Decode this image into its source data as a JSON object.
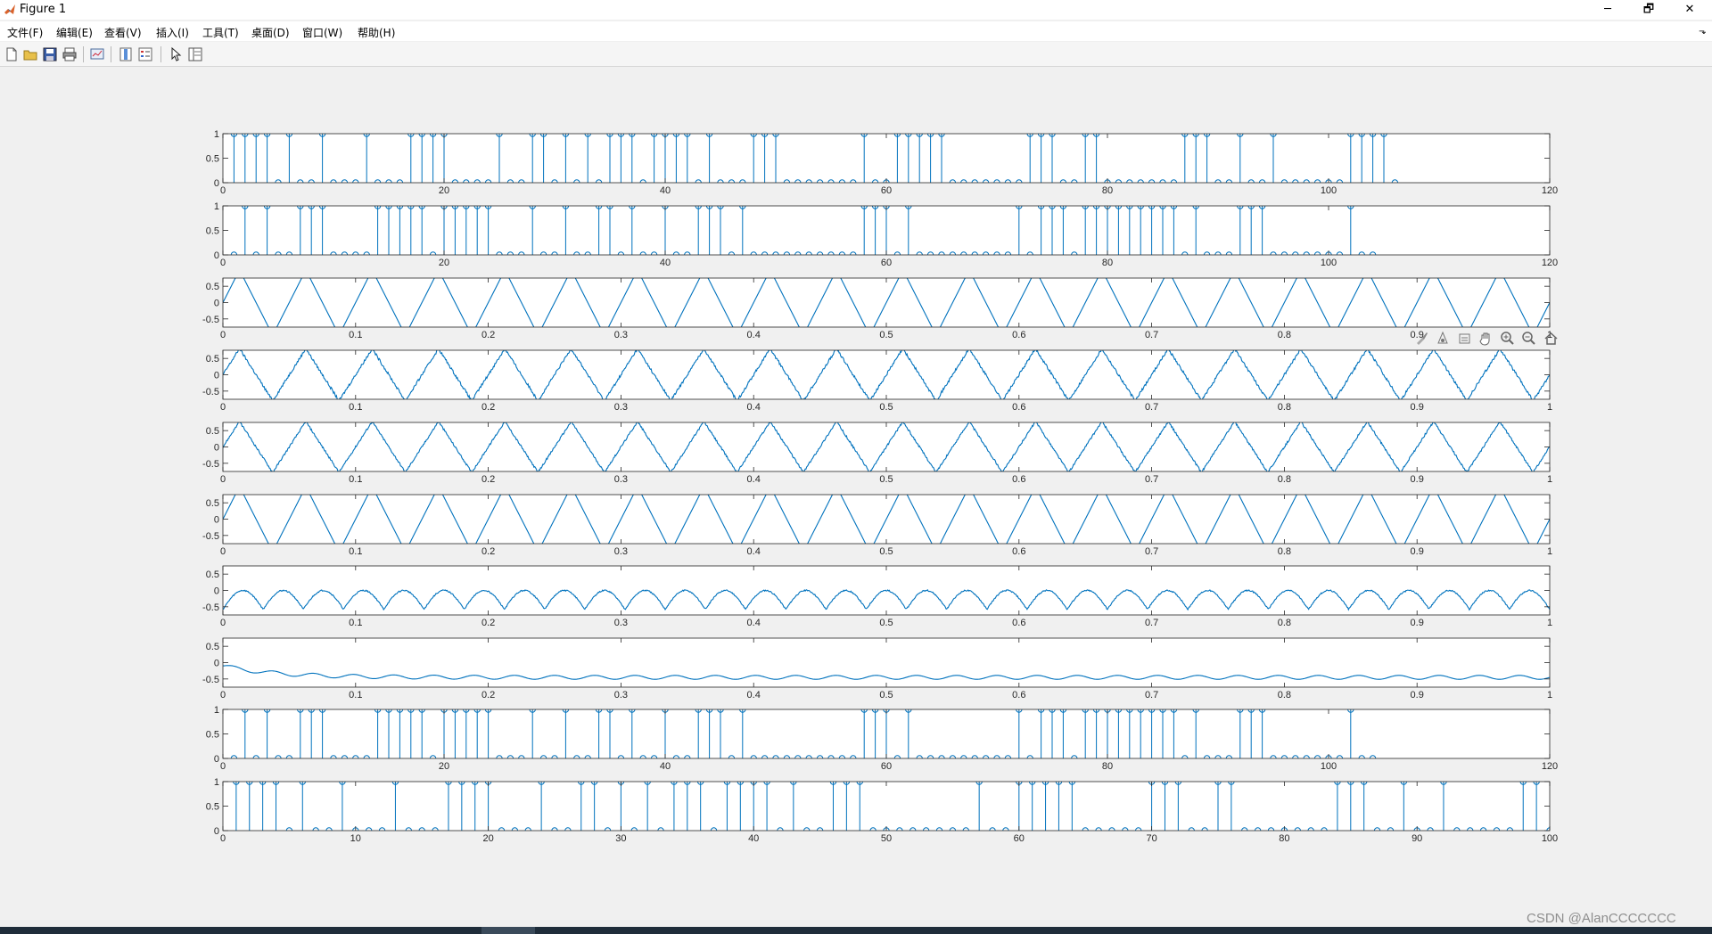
{
  "window": {
    "title": "Figure 1",
    "controls": {
      "minimize": "─",
      "maximize": "🗗",
      "close": "✕"
    }
  },
  "menu": {
    "items": [
      "文件(F)",
      "编辑(E)",
      "查看(V)",
      "插入(I)",
      "工具(T)",
      "桌面(D)",
      "窗口(W)",
      "帮助(H)"
    ],
    "overflow_arrow": "⬎"
  },
  "toolbar": {
    "icons": [
      "new-figure-icon",
      "open-file-icon",
      "save-icon",
      "print-icon",
      "link-plot-icon",
      "insert-colorbar-icon",
      "insert-legend-icon",
      "edit-plot-arrow-icon",
      "property-inspector-icon"
    ]
  },
  "axes_toolbar": {
    "icons": [
      "brush-icon",
      "data-tip-icon",
      "export-icon",
      "pan-hand-icon",
      "zoom-in-icon",
      "zoom-out-icon",
      "home-icon"
    ]
  },
  "colors": {
    "line": "#0072bd",
    "axes_bg": "#ffffff",
    "figure_bg": "#f0f0f0"
  },
  "watermark": "CSDN @AlanCCCCCCC",
  "chart_data": [
    {
      "type": "stem",
      "xlim": [
        0,
        120
      ],
      "ylim": [
        0,
        1
      ],
      "xticks": [
        "0",
        "20",
        "40",
        "60",
        "80",
        "100",
        "120"
      ],
      "yticks": [
        "0",
        "0.5",
        "1"
      ],
      "x_start": 1,
      "values": [
        1,
        1,
        1,
        1,
        0,
        1,
        0,
        0,
        1,
        0,
        0,
        0,
        1,
        0,
        0,
        0,
        1,
        1,
        1,
        1,
        0,
        0,
        0,
        0,
        1,
        0,
        0,
        1,
        1,
        0,
        1,
        0,
        1,
        0,
        1,
        1,
        1,
        0,
        1,
        1,
        1,
        1,
        0,
        1,
        0,
        0,
        0,
        1,
        1,
        1,
        0,
        0,
        0,
        0,
        0,
        0,
        0,
        1,
        0,
        0,
        1,
        1,
        1,
        1,
        1,
        0,
        0,
        0,
        0,
        0,
        0,
        0,
        1,
        1,
        1,
        0,
        0,
        1,
        1,
        0,
        0,
        0,
        0,
        0,
        0,
        0,
        1,
        1,
        1,
        0,
        0,
        1,
        0,
        0,
        1,
        0,
        0,
        0,
        0,
        0,
        0,
        1,
        1,
        1,
        1,
        0
      ]
    },
    {
      "type": "stem",
      "xlim": [
        0,
        120
      ],
      "ylim": [
        0,
        1
      ],
      "xticks": [
        "0",
        "20",
        "40",
        "60",
        "80",
        "100",
        "120"
      ],
      "yticks": [
        "0",
        "0.5",
        "1"
      ],
      "x_start": 1,
      "values": [
        0,
        1,
        0,
        1,
        0,
        0,
        1,
        1,
        1,
        0,
        0,
        0,
        0,
        1,
        1,
        1,
        1,
        1,
        0,
        1,
        1,
        1,
        1,
        1,
        0,
        0,
        0,
        1,
        0,
        0,
        1,
        0,
        0,
        1,
        1,
        0,
        1,
        0,
        0,
        1,
        0,
        0,
        1,
        1,
        1,
        0,
        1,
        0,
        0,
        0,
        0,
        0,
        0,
        0,
        0,
        0,
        0,
        1,
        1,
        1,
        0,
        1,
        0,
        0,
        0,
        0,
        0,
        0,
        0,
        0,
        0,
        1,
        0,
        1,
        1,
        1,
        0,
        1,
        1,
        1,
        1,
        1,
        1,
        1,
        1,
        1,
        0,
        1,
        0,
        0,
        0,
        1,
        1,
        1,
        0,
        0,
        0,
        0,
        0,
        0,
        0,
        1,
        0,
        0
      ]
    },
    {
      "type": "line",
      "shape": "triangle",
      "xlim": [
        0,
        1
      ],
      "ylim": [
        -0.75,
        0.75
      ],
      "xticks": [
        "0",
        "0.1",
        "0.2",
        "0.3",
        "0.4",
        "0.5",
        "0.6",
        "0.7",
        "0.8",
        "0.9",
        "1"
      ],
      "yticks": [
        "0.5",
        "0",
        "-0.5"
      ],
      "frequency": 20,
      "amplitude": 1,
      "noise": 0,
      "offset": 0
    },
    {
      "type": "line",
      "shape": "triangle",
      "xlim": [
        0,
        1
      ],
      "ylim": [
        -0.75,
        0.75
      ],
      "xticks": [
        "0",
        "0.1",
        "0.2",
        "0.3",
        "0.4",
        "0.5",
        "0.6",
        "0.7",
        "0.8",
        "0.9",
        "1"
      ],
      "yticks": [
        "0.5",
        "0",
        "-0.5"
      ],
      "frequency": 20,
      "amplitude": 0.8,
      "noise": 0.04,
      "offset": 0
    },
    {
      "type": "line",
      "shape": "triangle",
      "xlim": [
        0,
        1
      ],
      "ylim": [
        -0.75,
        0.75
      ],
      "xticks": [
        "0",
        "0.1",
        "0.2",
        "0.3",
        "0.4",
        "0.5",
        "0.6",
        "0.7",
        "0.8",
        "0.9",
        "1"
      ],
      "yticks": [
        "0.5",
        "0",
        "-0.5"
      ],
      "frequency": 20,
      "amplitude": 0.78,
      "noise": 0.03,
      "offset": 0
    },
    {
      "type": "line",
      "shape": "triangle",
      "xlim": [
        0,
        1
      ],
      "ylim": [
        -0.75,
        0.75
      ],
      "xticks": [
        "0",
        "0.1",
        "0.2",
        "0.3",
        "0.4",
        "0.5",
        "0.6",
        "0.7",
        "0.8",
        "0.9",
        "1"
      ],
      "yticks": [
        "0.5",
        "0",
        "-0.5"
      ],
      "frequency": 20,
      "amplitude": 1,
      "noise": 0,
      "offset": 0
    },
    {
      "type": "line",
      "shape": "bump",
      "xlim": [
        0,
        1
      ],
      "ylim": [
        -0.75,
        0.75
      ],
      "xticks": [
        "0",
        "0.1",
        "0.2",
        "0.3",
        "0.4",
        "0.5",
        "0.6",
        "0.7",
        "0.8",
        "0.9",
        "1"
      ],
      "yticks": [
        "0.5",
        "0",
        "-0.5"
      ],
      "frequency": 33,
      "amplitude": 0.58,
      "noise": 0.02,
      "offset": -0.58
    },
    {
      "type": "line",
      "shape": "ripple",
      "xlim": [
        0,
        1
      ],
      "ylim": [
        -0.75,
        0.75
      ],
      "xticks": [
        "0",
        "0.1",
        "0.2",
        "0.3",
        "0.4",
        "0.5",
        "0.6",
        "0.7",
        "0.8",
        "0.9",
        "1"
      ],
      "yticks": [
        "0.5",
        "0",
        "-0.5"
      ],
      "frequency": 33,
      "amplitude": 0.06,
      "noise": 0,
      "offset": -0.45
    },
    {
      "type": "stem",
      "xlim": [
        0,
        120
      ],
      "ylim": [
        0,
        1
      ],
      "xticks": [
        "0",
        "20",
        "40",
        "60",
        "80",
        "100",
        "120"
      ],
      "yticks": [
        "0",
        "0.5",
        "1"
      ],
      "x_start": 1,
      "values": [
        0,
        1,
        0,
        1,
        0,
        0,
        1,
        1,
        1,
        0,
        0,
        0,
        0,
        1,
        1,
        1,
        1,
        1,
        0,
        1,
        1,
        1,
        1,
        1,
        0,
        0,
        0,
        1,
        0,
        0,
        1,
        0,
        0,
        1,
        1,
        0,
        1,
        0,
        0,
        1,
        0,
        0,
        1,
        1,
        1,
        0,
        1,
        0,
        0,
        0,
        0,
        0,
        0,
        0,
        0,
        0,
        0,
        1,
        1,
        1,
        0,
        1,
        0,
        0,
        0,
        0,
        0,
        0,
        0,
        0,
        0,
        1,
        0,
        1,
        1,
        1,
        0,
        1,
        1,
        1,
        1,
        1,
        1,
        1,
        1,
        1,
        0,
        1,
        0,
        0,
        0,
        1,
        1,
        1,
        0,
        0,
        0,
        0,
        0,
        0,
        0,
        1,
        0,
        0
      ]
    },
    {
      "type": "stem",
      "xlim": [
        0,
        100
      ],
      "ylim": [
        0,
        1
      ],
      "xticks": [
        "0",
        "10",
        "20",
        "30",
        "40",
        "50",
        "60",
        "70",
        "80",
        "90",
        "100"
      ],
      "yticks": [
        "0",
        "0.5",
        "1"
      ],
      "x_start": 1,
      "values": [
        1,
        1,
        1,
        1,
        0,
        1,
        0,
        0,
        1,
        0,
        0,
        0,
        1,
        0,
        0,
        0,
        1,
        1,
        1,
        1,
        0,
        0,
        0,
        1,
        0,
        0,
        1,
        1,
        0,
        1,
        0,
        1,
        0,
        1,
        1,
        1,
        0,
        1,
        1,
        1,
        1,
        0,
        1,
        0,
        0,
        1,
        1,
        1,
        0,
        0,
        0,
        0,
        0,
        0,
        0,
        0,
        1,
        0,
        0,
        1,
        1,
        1,
        1,
        1,
        0,
        0,
        0,
        0,
        0,
        1,
        1,
        1,
        0,
        0,
        1,
        1,
        0,
        0,
        0,
        0,
        0,
        0,
        0,
        1,
        1,
        1,
        0,
        0,
        1,
        0,
        0,
        1,
        0,
        0,
        0,
        0,
        0,
        1,
        1,
        0
      ]
    }
  ]
}
